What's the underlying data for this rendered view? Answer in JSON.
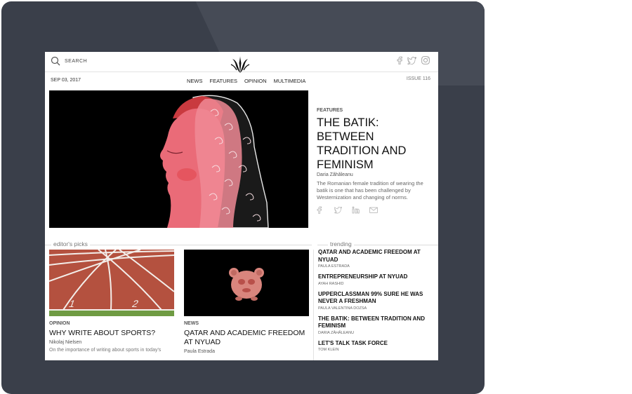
{
  "header": {
    "search_label": "SEARCH",
    "date": "SEP 03, 2017",
    "nav": [
      "NEWS",
      "FEATURES",
      "OPINION",
      "MULTIMEDIA"
    ],
    "issue": "ISSUE 116",
    "socials": [
      "facebook-icon",
      "twitter-icon",
      "instagram-icon"
    ]
  },
  "feature": {
    "category": "FEATURES",
    "title": "THE BATIK: BETWEEN TRADITION AND FEMINISM",
    "author": "Daria Zăhăleanu",
    "description": "The Romanian female tradition of wearing the batik is one that has been challenged by Westernization and changing of norms.",
    "share_icons": [
      "facebook-icon",
      "twitter-icon",
      "linkedin-icon",
      "mail-icon"
    ]
  },
  "editors_picks": {
    "label": "editor's picks",
    "items": [
      {
        "category": "OPINION",
        "title": "WHY WRITE ABOUT SPORTS?",
        "author": "Nikolaj Nielsen",
        "description": "On the importance of writing about sports in today's"
      },
      {
        "category": "NEWS",
        "title": "QATAR AND ACADEMIC FREEDOM AT NYUAD",
        "author": "Paula Estrada",
        "description": ""
      }
    ]
  },
  "trending": {
    "label": "trending",
    "items": [
      {
        "title": "QATAR AND ACADEMIC FREEDOM AT NYUAD",
        "author": "PAULA ESTRADA"
      },
      {
        "title": "ENTREPRENEURSHIP AT NYUAD",
        "author": "AYAH RASHID"
      },
      {
        "title": "UPPERCLASSMAN 99% SURE HE WAS NEVER A FRESHMAN",
        "author": "PAULA VALENTINA DOZSA"
      },
      {
        "title": "THE BATIK: BETWEEN TRADITION AND FEMINISM",
        "author": "DARIA ZĂHĂLEANU"
      },
      {
        "title": "LET'S TALK TASK FORCE",
        "author": "TOM KLEIN"
      }
    ]
  },
  "colors": {
    "device_frame": "#3a3f4a",
    "hero_face": "#ea6b78",
    "track": "#b4513f",
    "emoji": "#d9857d"
  }
}
